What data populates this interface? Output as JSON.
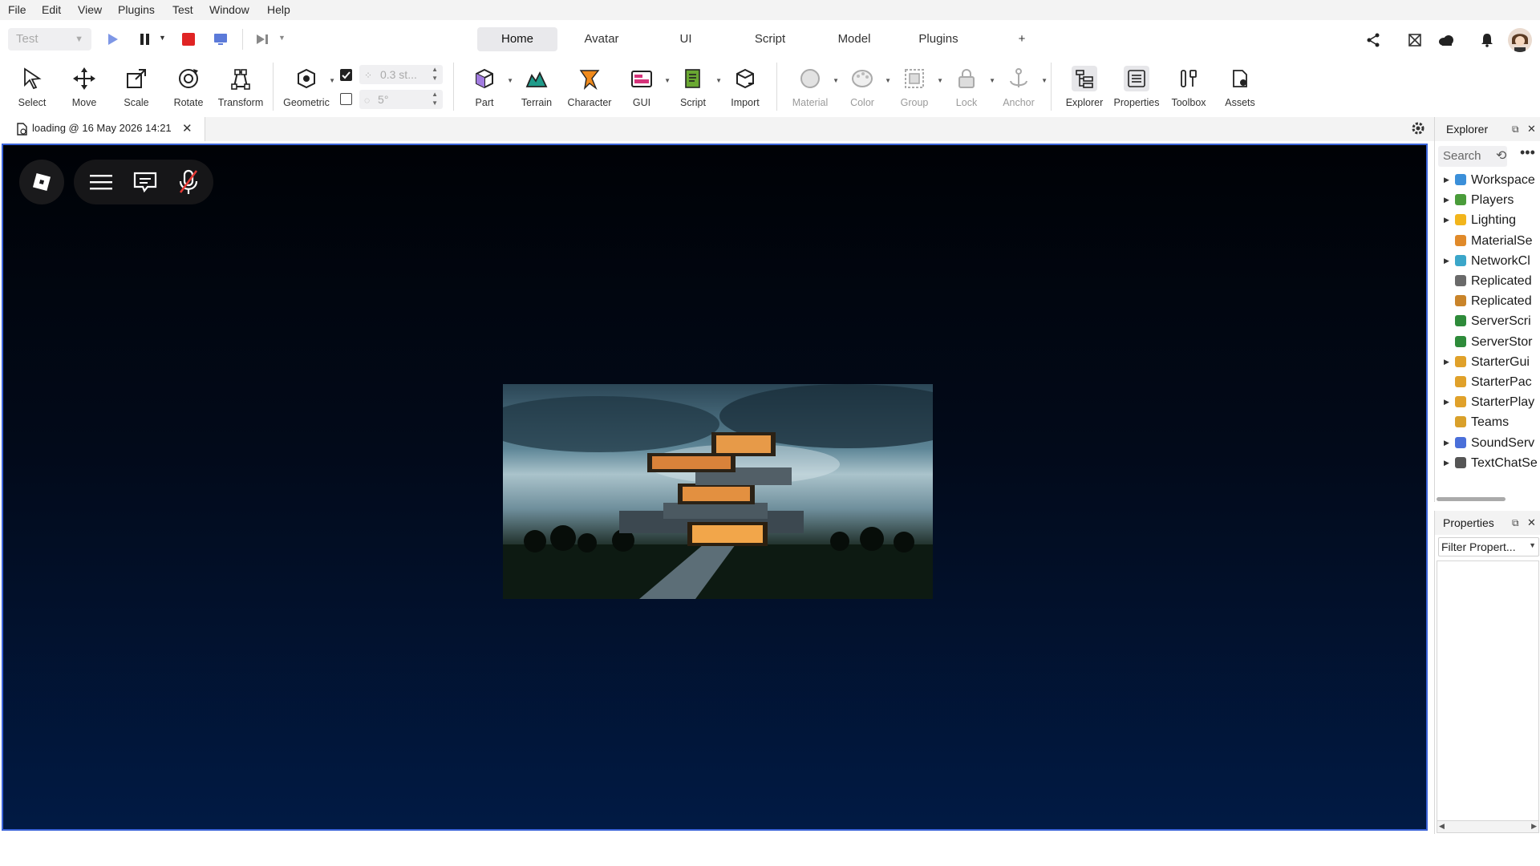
{
  "menu": [
    "File",
    "Edit",
    "View",
    "Plugins",
    "Test",
    "Window",
    "Help"
  ],
  "toolbar": {
    "mode_select": "Test",
    "tabs": [
      "Home",
      "Avatar",
      "UI",
      "Script",
      "Model",
      "Plugins",
      "+"
    ],
    "active_tab": "Home",
    "tools": {
      "select": "Select",
      "move": "Move",
      "scale": "Scale",
      "rotate": "Rotate",
      "transform": "Transform",
      "geometric": "Geometric",
      "part": "Part",
      "terrain": "Terrain",
      "character": "Character",
      "gui": "GUI",
      "script": "Script",
      "import": "Import",
      "material": "Material",
      "color": "Color",
      "group": "Group",
      "lock": "Lock",
      "anchor": "Anchor",
      "explorer": "Explorer",
      "properties": "Properties",
      "toolbox": "Toolbox",
      "assets": "Assets"
    },
    "snap_move_value": "0.3 st...",
    "snap_rotate_value": "5°",
    "snap_move_checked": true,
    "snap_rotate_checked": false
  },
  "document_tab": {
    "title": "loading @ 16 May 2026 14:21"
  },
  "explorer": {
    "title": "Explorer",
    "search_placeholder": "Search",
    "items": [
      {
        "label": "Workspace",
        "expandable": true,
        "icon": "workspace-icon",
        "color": "#3b8fd9"
      },
      {
        "label": "Players",
        "expandable": true,
        "icon": "players-icon",
        "color": "#4a9c3a"
      },
      {
        "label": "Lighting",
        "expandable": true,
        "icon": "lighting-icon",
        "color": "#f2b51c"
      },
      {
        "label": "MaterialSe",
        "expandable": false,
        "icon": "material-service-icon",
        "color": "#e08a2a"
      },
      {
        "label": "NetworkCl",
        "expandable": true,
        "icon": "network-client-icon",
        "color": "#3ba6c9"
      },
      {
        "label": "Replicated",
        "expandable": false,
        "icon": "replicated-first-icon",
        "color": "#6a6a6a"
      },
      {
        "label": "Replicated",
        "expandable": false,
        "icon": "replicated-storage-icon",
        "color": "#c9842a"
      },
      {
        "label": "ServerScri",
        "expandable": false,
        "icon": "server-script-service-icon",
        "color": "#2e8b3a"
      },
      {
        "label": "ServerStor",
        "expandable": false,
        "icon": "server-storage-icon",
        "color": "#2e8b3a"
      },
      {
        "label": "StarterGui",
        "expandable": true,
        "icon": "starter-gui-icon",
        "color": "#e0a12a"
      },
      {
        "label": "StarterPac",
        "expandable": false,
        "icon": "starter-pack-icon",
        "color": "#e0a12a"
      },
      {
        "label": "StarterPlay",
        "expandable": true,
        "icon": "starter-player-icon",
        "color": "#e0a12a"
      },
      {
        "label": "Teams",
        "expandable": false,
        "icon": "teams-icon",
        "color": "#d9a02a"
      },
      {
        "label": "SoundServ",
        "expandable": true,
        "icon": "sound-service-icon",
        "color": "#4a6fd9"
      },
      {
        "label": "TextChatSe",
        "expandable": true,
        "icon": "text-chat-service-icon",
        "color": "#555555"
      }
    ]
  },
  "properties": {
    "title": "Properties",
    "filter_placeholder": "Filter Propert..."
  },
  "colors": {
    "accent_blue": "#3a63d8",
    "stop_red": "#e02424",
    "character_orange": "#f08a1c",
    "gui_pink": "#d6337a",
    "script_green": "#6aa832",
    "terrain_teal": "#1f9b8a"
  }
}
